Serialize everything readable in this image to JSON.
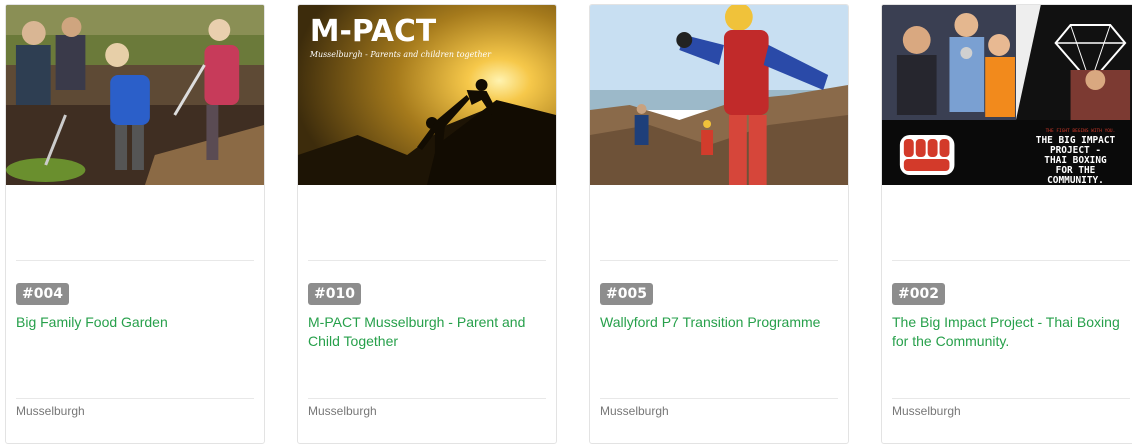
{
  "cards": [
    {
      "badge": "#004",
      "title": "Big Family Food Garden",
      "location": "Musselburgh",
      "image_icon": "garden-photo"
    },
    {
      "badge": "#010",
      "title": "M-PACT Musselburgh - Parent and Child Together",
      "location": "Musselburgh",
      "image_icon": "sunset-climb-photo",
      "image_title": "M-PACT",
      "image_subtitle": "Musselburgh - Parents and children together"
    },
    {
      "badge": "#005",
      "title": "Wallyford P7 Transition Programme",
      "location": "Musselburgh",
      "image_icon": "coast-climbing-photo"
    },
    {
      "badge": "#002",
      "title": "The Big Impact Project - Thai Boxing for the Community.",
      "location": "Musselburgh",
      "image_icon": "boxing-poster-photo",
      "image_caption_small": "THE FIGHT BEGINS WITH YOU.",
      "image_caption_lines": [
        "THE BIG IMPACT",
        "PROJECT -",
        "THAI BOXING",
        "FOR THE",
        "COMMUNITY."
      ]
    }
  ],
  "colors": {
    "title_link": "#27a04b",
    "badge_bg": "#8d8d8d",
    "location_text": "#777777",
    "card_border": "#e3e3e3"
  }
}
